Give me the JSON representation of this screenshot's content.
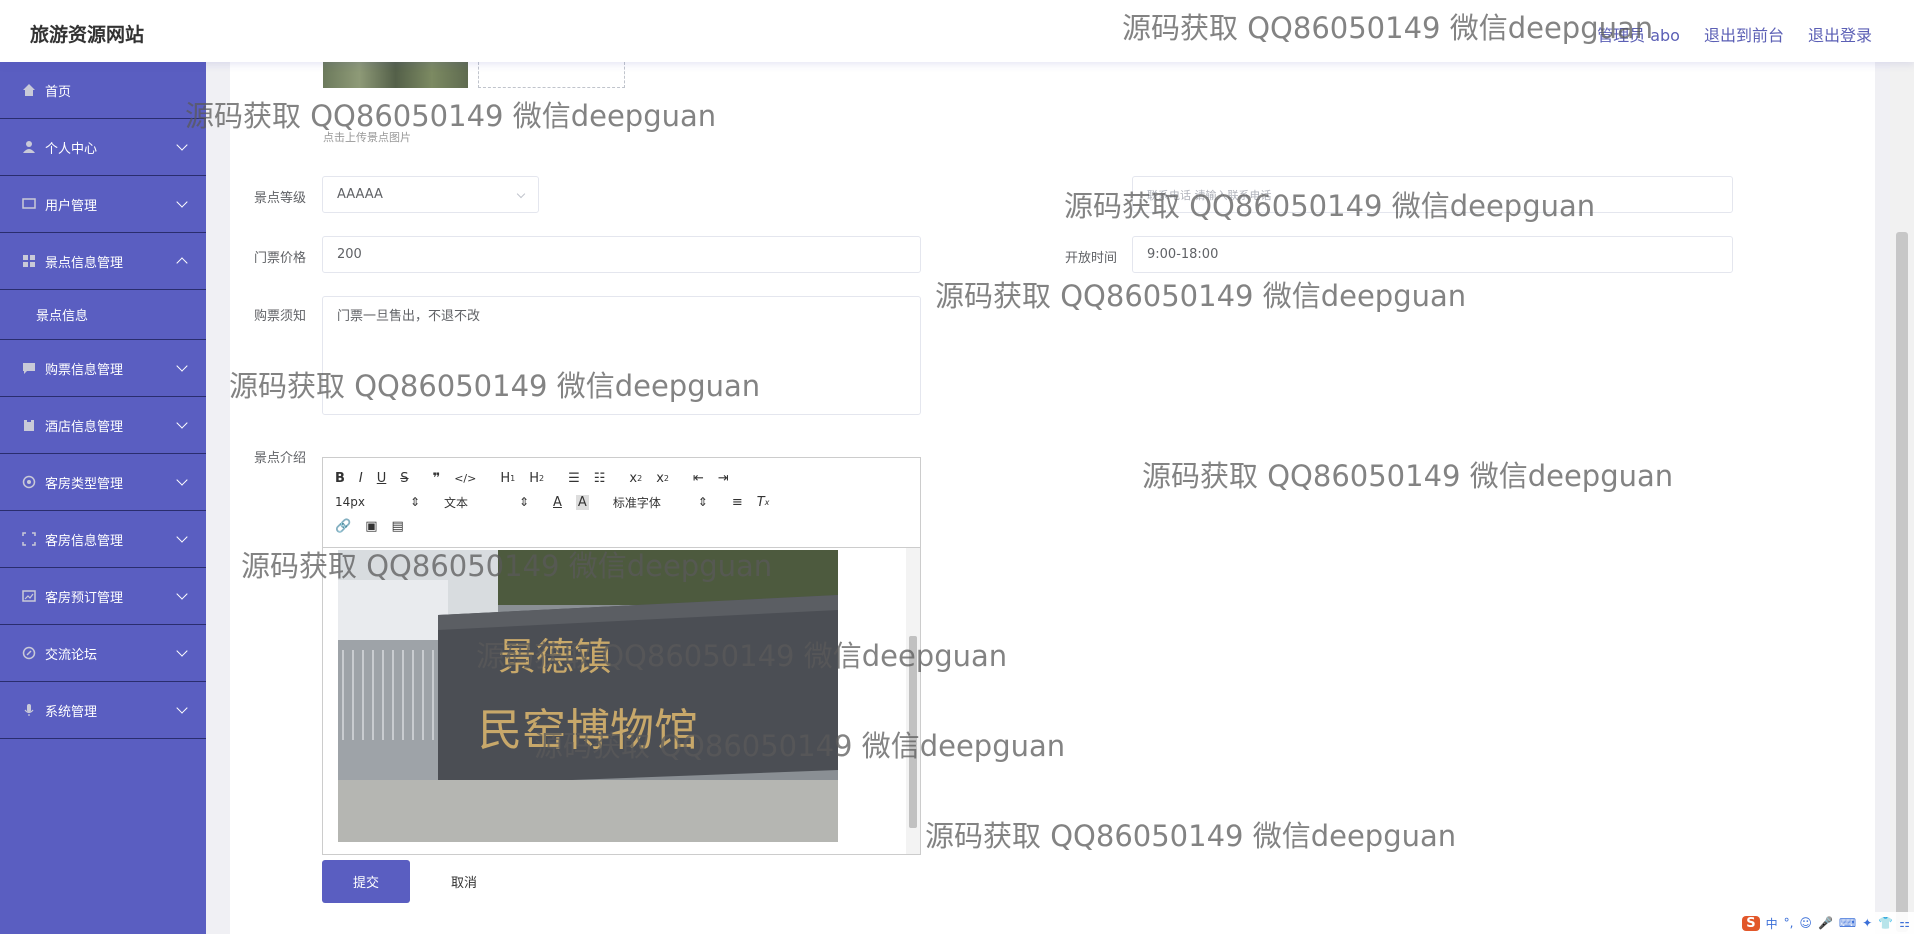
{
  "header": {
    "brand": "旅游资源网站",
    "admin_label": "管理员 abo",
    "to_front_label": "退出到前台",
    "logout_label": "退出登录"
  },
  "sidebar": {
    "items": [
      {
        "label": "首页",
        "icon": "home-icon"
      },
      {
        "label": "个人中心",
        "icon": "user-icon"
      },
      {
        "label": "用户管理",
        "icon": "chat-icon"
      },
      {
        "label": "景点信息管理",
        "icon": "grid-icon"
      },
      {
        "label": "景点信息",
        "icon": ""
      },
      {
        "label": "购票信息管理",
        "icon": "message-icon"
      },
      {
        "label": "酒店信息管理",
        "icon": "clipboard-icon"
      },
      {
        "label": "客房类型管理",
        "icon": "settings-icon"
      },
      {
        "label": "客房信息管理",
        "icon": "frame-icon"
      },
      {
        "label": "客房预订管理",
        "icon": "picture-icon"
      },
      {
        "label": "交流论坛",
        "icon": "compass-icon"
      },
      {
        "label": "系统管理",
        "icon": "mic-icon"
      }
    ]
  },
  "form": {
    "upload_hint": "点击上传景点图片",
    "level_label": "景点等级",
    "level_value": "AAAAA",
    "phone_placeholder": "联系电话 请输入联系电话",
    "price_label": "门票价格",
    "price_value": "200",
    "open_time_label": "开放时间",
    "open_time_value": "9:00-18:00",
    "notice_label": "购票须知",
    "notice_value": "门票一旦售出，不退不改",
    "intro_label": "景点介绍",
    "submit_label": "提交",
    "cancel_label": "取消"
  },
  "editor": {
    "font_size": "14px",
    "text_type": "文本",
    "font_family": "标准字体",
    "photo_caption": "景德镇民窑博物馆"
  },
  "watermark": "源码获取 QQ86050149 微信deepguan",
  "tray": {
    "logo": "S",
    "items": [
      "中",
      "°,",
      "☺",
      "🎤",
      "⌨",
      "✦",
      "👕",
      "⚏"
    ]
  }
}
